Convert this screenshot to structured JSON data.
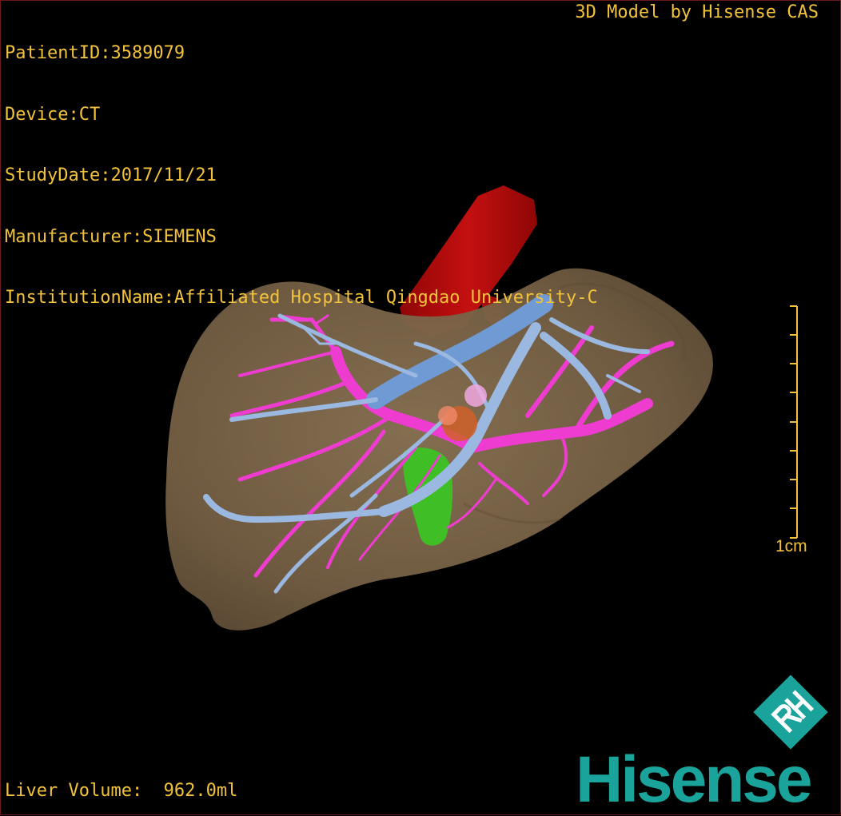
{
  "info": {
    "patient_id": "PatientID:3589079",
    "device": "Device:CT",
    "study_date": "StudyDate:2017/11/21",
    "manufacturer": "Manufacturer:SIEMENS",
    "institution": "InstitutionName:Affiliated Hospital Qingdao University-C"
  },
  "credit": "3D Model by Hisense CAS",
  "liver_volume": "Liver Volume:  962.0ml",
  "scale_bar": {
    "label": "1cm"
  },
  "brand": {
    "name": "Hisense",
    "badge": "RH"
  },
  "colors": {
    "text": "#f2c23a",
    "liver": "#7a6549",
    "aorta": "#b30a0a",
    "hepatic_vein": "#9ab8e0",
    "portal_vein": "#ee3cd0",
    "gallbladder": "#3fbf25",
    "brand": "#1aa39a"
  }
}
